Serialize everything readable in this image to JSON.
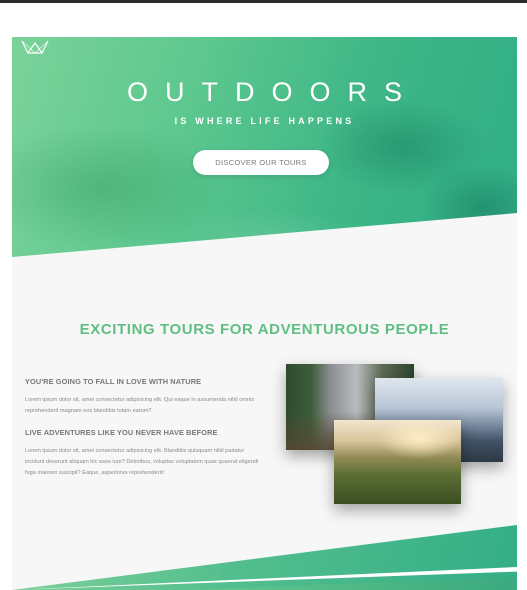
{
  "hero": {
    "title": "OUTDOORS",
    "subtitle": "IS WHERE LIFE HAPPENS",
    "button_label": "DISCOVER OUR TOURS",
    "logo_icon": "crown-logo-icon"
  },
  "about": {
    "heading": "EXCITING TOURS FOR ADVENTUROUS PEOPLE",
    "blocks": [
      {
        "title": "YOU'RE GOING TO FALL IN LOVE WITH NATURE",
        "text": "Lorem ipsum dolor sit, amet consectetur adipisicing elit. Qui eaque in assumenda nihil omnis reprehenderit magnam eos blanditiis totam earum?"
      },
      {
        "title": "LIVE ADVENTURES LIKE YOU NEVER HAVE BEFORE",
        "text": "Lorem ipsum dolor sit, amet consectetur adipisicing elit. Blanditiis quisquam nihil pariatur incidunt deserunt aliquam hic esse iure? Doloribus, voluptas voluptatem quae quaerat eligendi fuga maiores suscipit? Eaque, asperiores reprehenderit!"
      }
    ],
    "photos": [
      "mountain-valley-photo",
      "ocean-cliff-photo",
      "sunset-ridge-photo"
    ]
  },
  "colors": {
    "accent_green": "#5fbf82",
    "hero_light": "#7bd39a",
    "hero_dark": "#2fae86",
    "text_gray": "#777777"
  }
}
